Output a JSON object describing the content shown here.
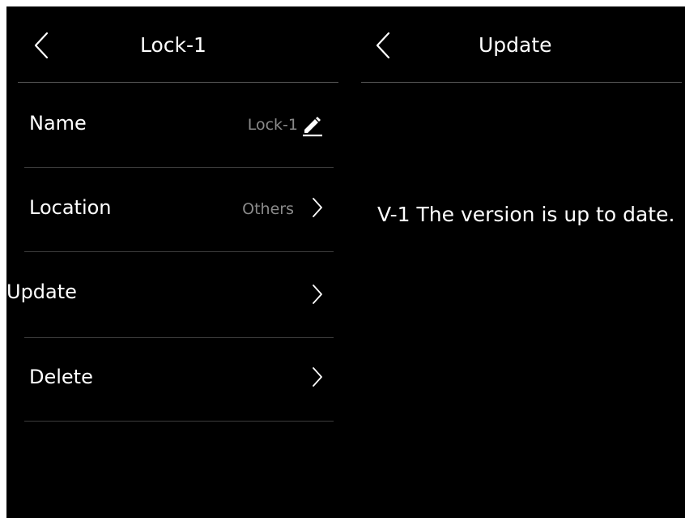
{
  "left_panel": {
    "title": "Lock-1",
    "rows": [
      {
        "label": "Name",
        "value": "Lock-1",
        "icon": "pencil-icon"
      },
      {
        "label": "Location",
        "value": "Others",
        "icon": "chevron-right-icon"
      },
      {
        "label": "Update",
        "value": "",
        "icon": "chevron-right-icon"
      },
      {
        "label": "Delete",
        "value": "",
        "icon": "chevron-right-icon"
      }
    ]
  },
  "right_panel": {
    "title": "Update",
    "message": "V-1 The version is up to date."
  },
  "colors": {
    "background": "#000000",
    "text": "#ffffff",
    "secondary_text": "#8a8a8a",
    "divider": "#3c3c3c"
  }
}
